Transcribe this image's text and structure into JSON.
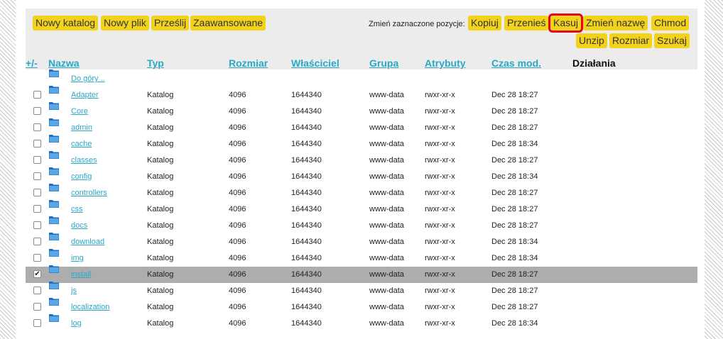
{
  "toolbar": {
    "new_folder": "Nowy katalog",
    "new_file": "Nowy plik",
    "upload": "Prześlij",
    "advanced": "Zaawansowane",
    "change_selected_label": "Zmień zaznaczone pozycje:",
    "copy": "Kopiuj",
    "move": "Przenieś",
    "delete": "Kasuj",
    "rename": "Zmień nazwę",
    "chmod": "Chmod",
    "unzip": "Unzip",
    "size": "Rozmiar",
    "search": "Szukaj"
  },
  "columns": {
    "toggle": "+/-",
    "name": "Nazwa",
    "type": "Typ",
    "size": "Rozmiar",
    "owner": "Właściciel",
    "group": "Grupa",
    "attributes": "Atrybuty",
    "modified": "Czas mod.",
    "actions": "Działania"
  },
  "up_link": "Do góry ..",
  "rows": [
    {
      "name": "Adapter",
      "type": "Katalog",
      "size": "4096",
      "owner": "1644340",
      "group": "www-data",
      "attrs": "rwxr-xr-x",
      "mtime": "Dec 28 18:27",
      "checked": false
    },
    {
      "name": "Core",
      "type": "Katalog",
      "size": "4096",
      "owner": "1644340",
      "group": "www-data",
      "attrs": "rwxr-xr-x",
      "mtime": "Dec 28 18:27",
      "checked": false
    },
    {
      "name": "admin",
      "type": "Katalog",
      "size": "4096",
      "owner": "1644340",
      "group": "www-data",
      "attrs": "rwxr-xr-x",
      "mtime": "Dec 28 18:27",
      "checked": false
    },
    {
      "name": "cache",
      "type": "Katalog",
      "size": "4096",
      "owner": "1644340",
      "group": "www-data",
      "attrs": "rwxr-xr-x",
      "mtime": "Dec 28 18:34",
      "checked": false
    },
    {
      "name": "classes",
      "type": "Katalog",
      "size": "4096",
      "owner": "1644340",
      "group": "www-data",
      "attrs": "rwxr-xr-x",
      "mtime": "Dec 28 18:27",
      "checked": false
    },
    {
      "name": "config",
      "type": "Katalog",
      "size": "4096",
      "owner": "1644340",
      "group": "www-data",
      "attrs": "rwxr-xr-x",
      "mtime": "Dec 28 18:34",
      "checked": false
    },
    {
      "name": "controllers",
      "type": "Katalog",
      "size": "4096",
      "owner": "1644340",
      "group": "www-data",
      "attrs": "rwxr-xr-x",
      "mtime": "Dec 28 18:27",
      "checked": false
    },
    {
      "name": "css",
      "type": "Katalog",
      "size": "4096",
      "owner": "1644340",
      "group": "www-data",
      "attrs": "rwxr-xr-x",
      "mtime": "Dec 28 18:27",
      "checked": false
    },
    {
      "name": "docs",
      "type": "Katalog",
      "size": "4096",
      "owner": "1644340",
      "group": "www-data",
      "attrs": "rwxr-xr-x",
      "mtime": "Dec 28 18:27",
      "checked": false
    },
    {
      "name": "download",
      "type": "Katalog",
      "size": "4096",
      "owner": "1644340",
      "group": "www-data",
      "attrs": "rwxr-xr-x",
      "mtime": "Dec 28 18:34",
      "checked": false
    },
    {
      "name": "img",
      "type": "Katalog",
      "size": "4096",
      "owner": "1644340",
      "group": "www-data",
      "attrs": "rwxr-xr-x",
      "mtime": "Dec 28 18:34",
      "checked": false
    },
    {
      "name": "install",
      "type": "Katalog",
      "size": "4096",
      "owner": "1644340",
      "group": "www-data",
      "attrs": "rwxr-xr-x",
      "mtime": "Dec 28 18:27",
      "checked": true
    },
    {
      "name": "js",
      "type": "Katalog",
      "size": "4096",
      "owner": "1644340",
      "group": "www-data",
      "attrs": "rwxr-xr-x",
      "mtime": "Dec 28 18:27",
      "checked": false
    },
    {
      "name": "localization",
      "type": "Katalog",
      "size": "4096",
      "owner": "1644340",
      "group": "www-data",
      "attrs": "rwxr-xr-x",
      "mtime": "Dec 28 18:27",
      "checked": false
    },
    {
      "name": "log",
      "type": "Katalog",
      "size": "4096",
      "owner": "1644340",
      "group": "www-data",
      "attrs": "rwxr-xr-x",
      "mtime": "Dec 28 18:34",
      "checked": false
    }
  ],
  "colors": {
    "accent_button": "#f2d21b",
    "link": "#2aa8c7",
    "highlight_border": "#e3061a",
    "selected_row": "#adadad"
  },
  "icons": {
    "row_icon": "folder-icon"
  }
}
